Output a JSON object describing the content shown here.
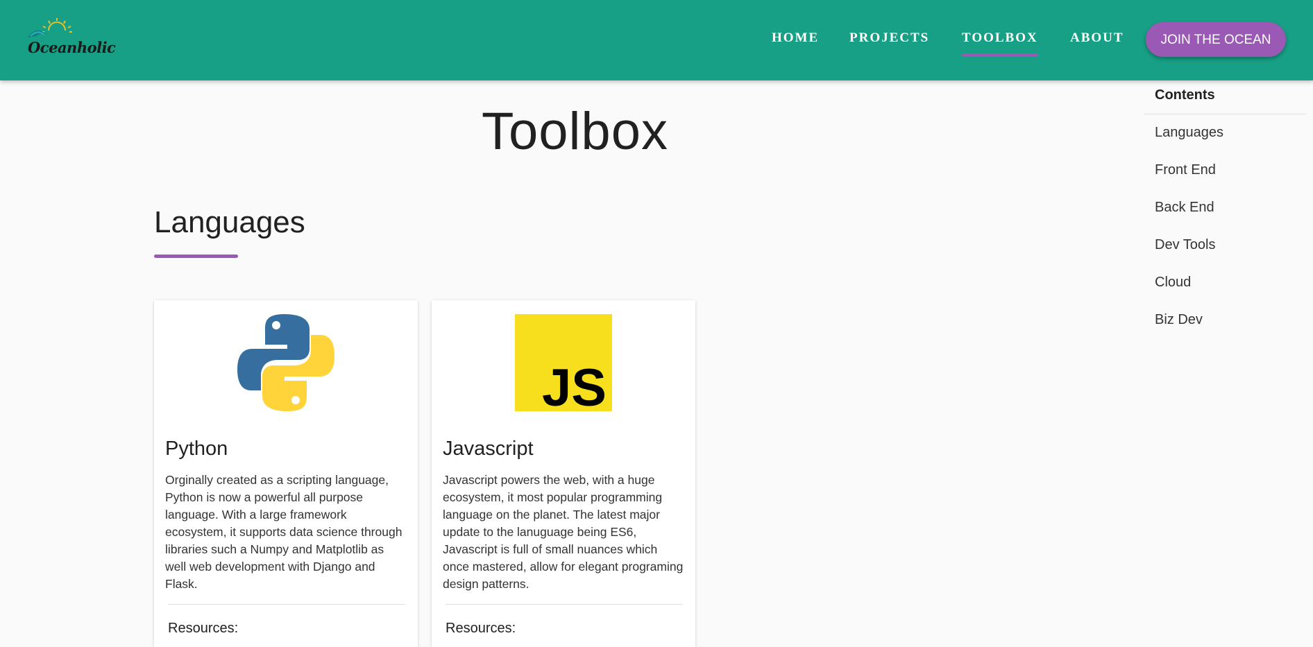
{
  "header": {
    "logo_text": "Oceanholic",
    "nav": [
      {
        "label": "HOME"
      },
      {
        "label": "PROJECTS"
      },
      {
        "label": "TOOLBOX",
        "active": true
      },
      {
        "label": "ABOUT"
      }
    ],
    "cta_label": "JOIN THE OCEAN"
  },
  "page": {
    "title": "Toolbox",
    "section_title": "Languages"
  },
  "cards": [
    {
      "title": "Python",
      "icon": "python-logo-icon",
      "description": "Orginally created as a scripting language, Python is now a powerful all purpose language. With a large framework ecosystem, it supports data science through libraries such a Numpy and Matplotlib as well web development with Django and Flask.",
      "resources_label": "Resources:"
    },
    {
      "title": "Javascript",
      "icon": "javascript-logo-icon",
      "icon_text": "JS",
      "description": "Javascript powers the web, with a huge ecosystem, it most popular programming language on the planet. The latest major update to the lanuguage being ES6, Javascript is full of small nuances which once mastered, allow for elegant programing design patterns.",
      "resources_label": "Resources:"
    }
  ],
  "toc": {
    "heading": "Contents",
    "items": [
      "Languages",
      "Front End",
      "Back End",
      "Dev Tools",
      "Cloud",
      "Biz Dev"
    ]
  },
  "colors": {
    "header_bg": "#17a085",
    "accent": "#9b59b6",
    "python_blue": "#366f9f",
    "python_yellow": "#ffd43b",
    "js_yellow": "#f7df1e"
  }
}
